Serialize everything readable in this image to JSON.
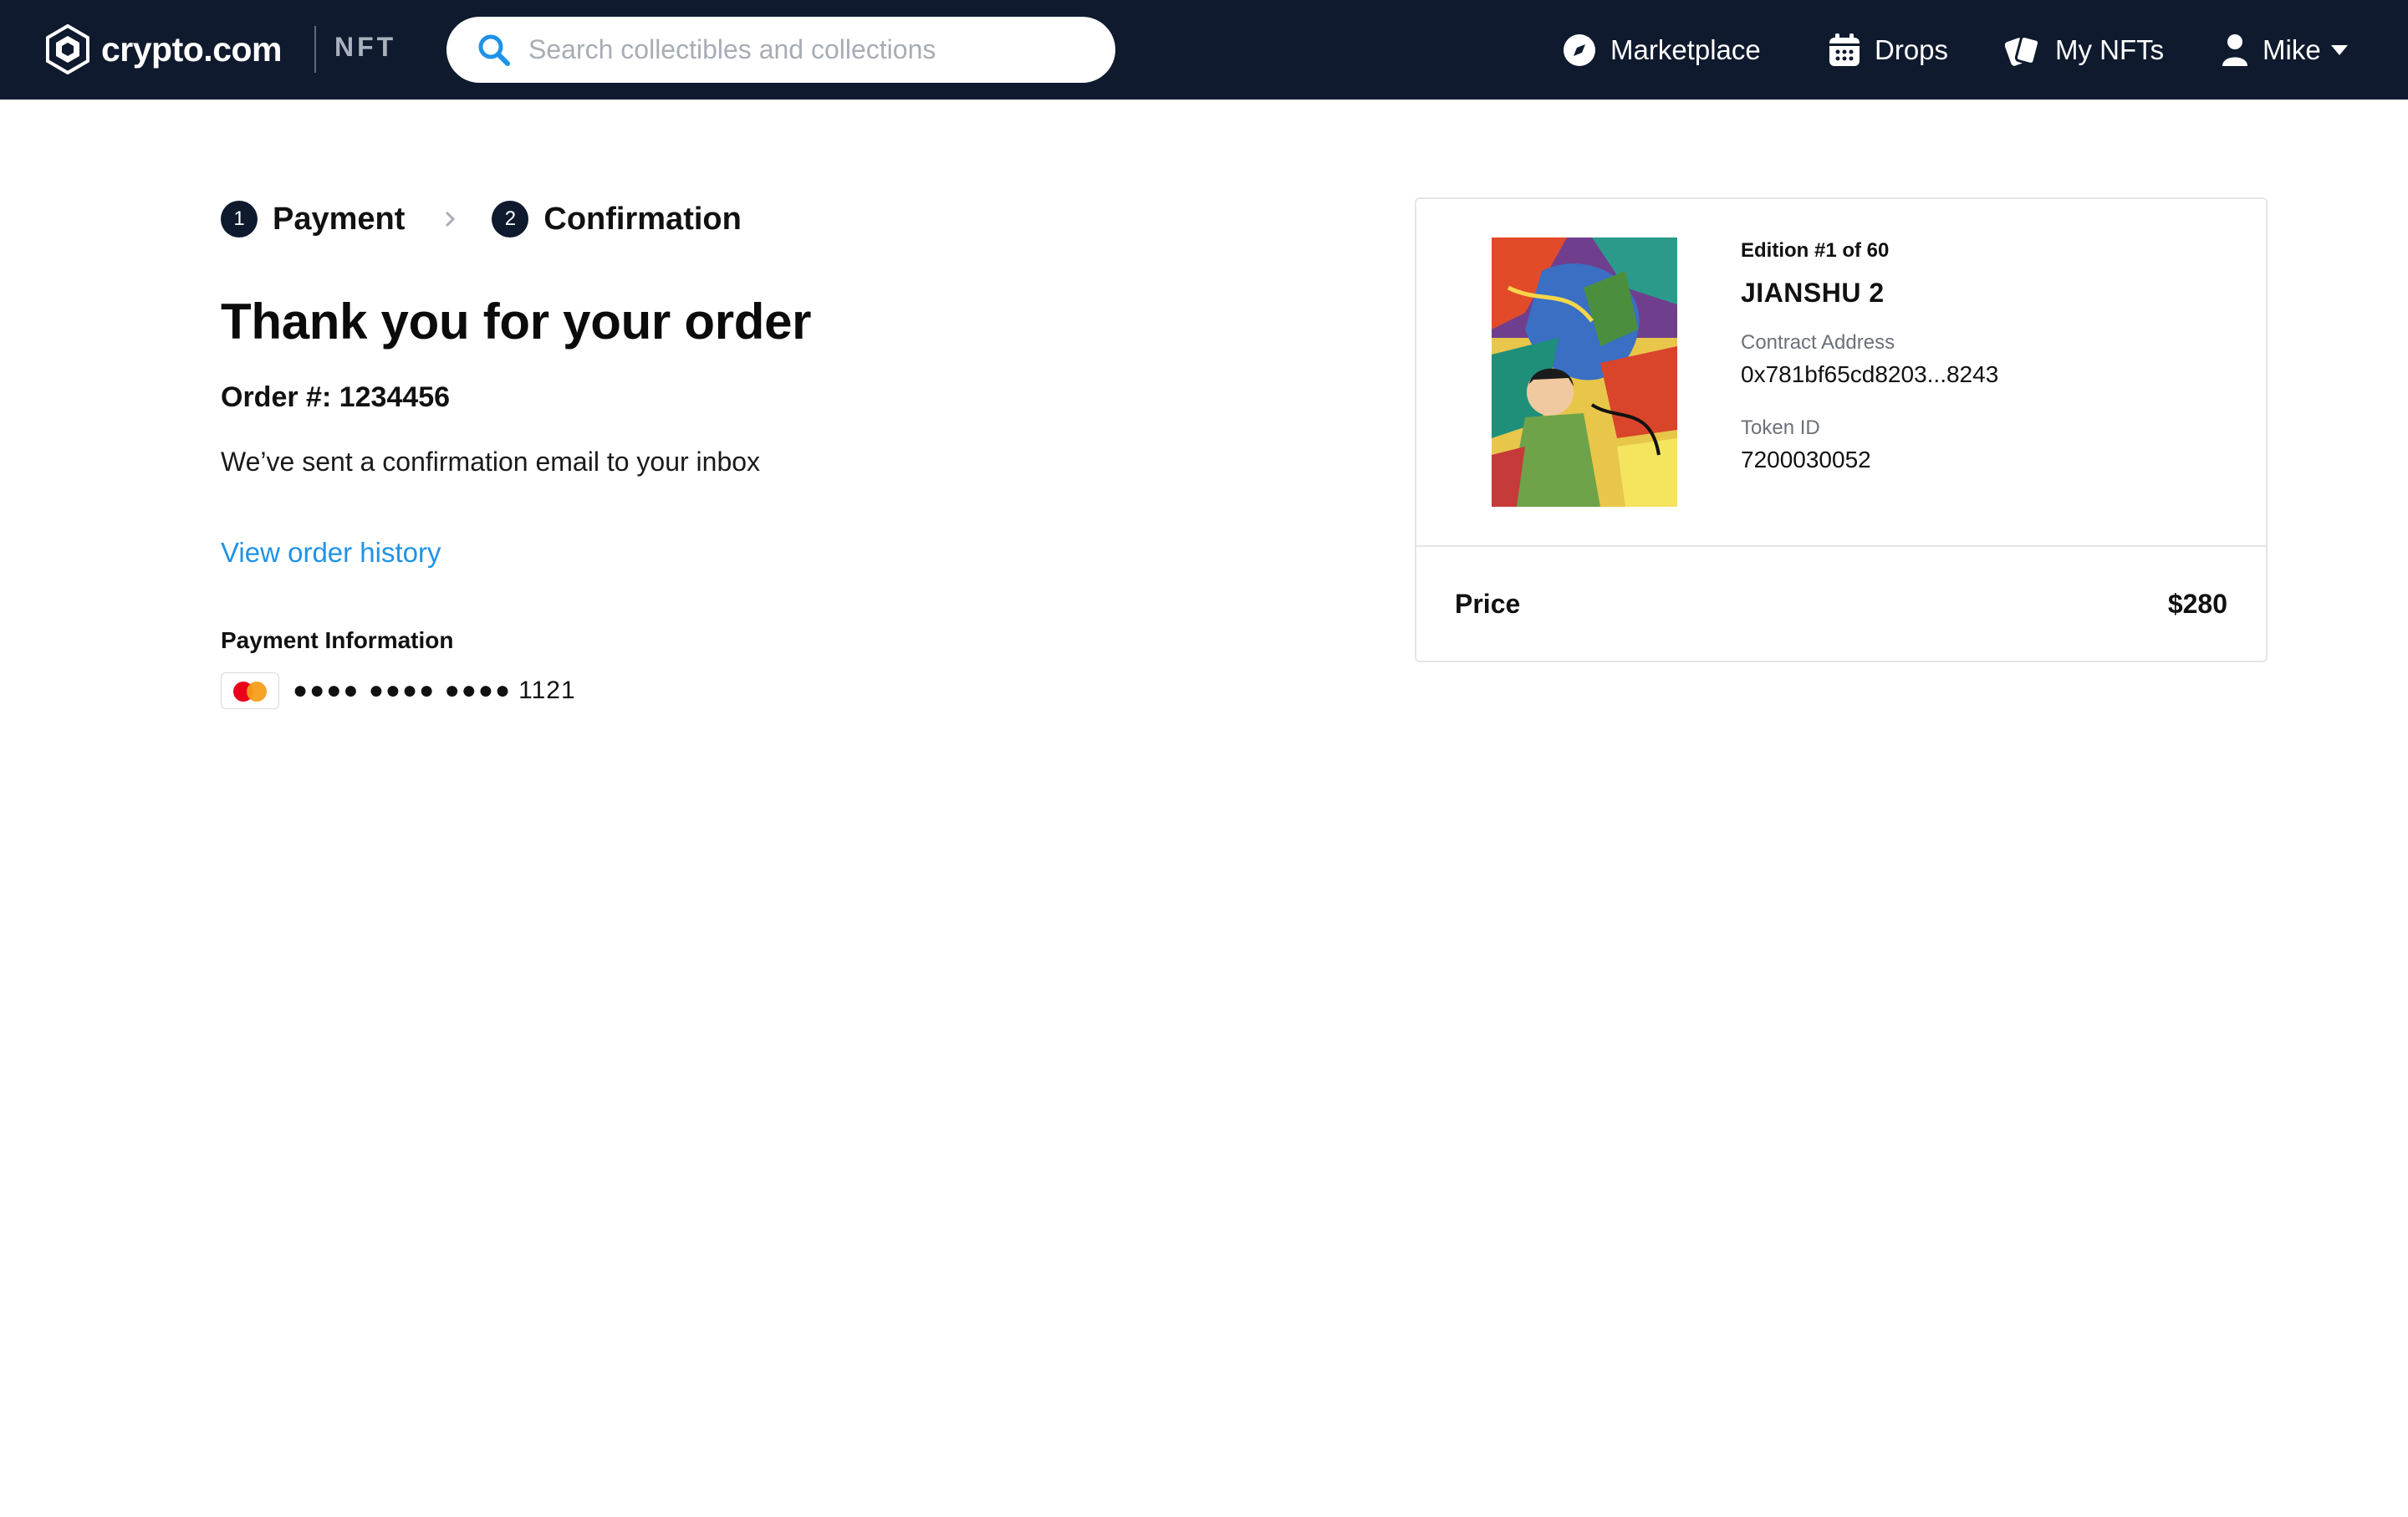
{
  "header": {
    "logo_text": "crypto.com",
    "logo_sub": "NFT",
    "search_placeholder": "Search collectibles and collections",
    "nav": {
      "marketplace": "Marketplace",
      "drops": "Drops",
      "my_nfts": "My NFTs",
      "user": "Mike"
    },
    "icons": {
      "logo": "crypto-com-lion-icon",
      "search": "search-icon",
      "marketplace": "compass-icon",
      "drops": "calendar-icon",
      "my_nfts": "nft-cards-icon",
      "user": "user-icon"
    },
    "colors": {
      "bar": "#0f1a2e",
      "accent": "#1e93e6"
    }
  },
  "steps": [
    {
      "number": "1",
      "label": "Payment"
    },
    {
      "number": "2",
      "label": "Confirmation"
    }
  ],
  "confirmation": {
    "title": "Thank you for your order",
    "order_number": "Order #: 1234456",
    "message": "We’ve sent a confirmation email to your inbox",
    "history_link": "View order history",
    "payment_heading": "Payment Information",
    "card_mask": "●●●● ●●●● ●●●●",
    "card_last4": "1121",
    "card_brand": "mastercard-icon"
  },
  "summary": {
    "edition": "Edition #1 of 60",
    "name": "JIANSHU 2",
    "contract_label": "Contract Address",
    "contract_value": "0x781bf65cd8203...8243",
    "token_label": "Token ID",
    "token_value": "7200030052",
    "price_label": "Price",
    "price_value": "$280"
  }
}
